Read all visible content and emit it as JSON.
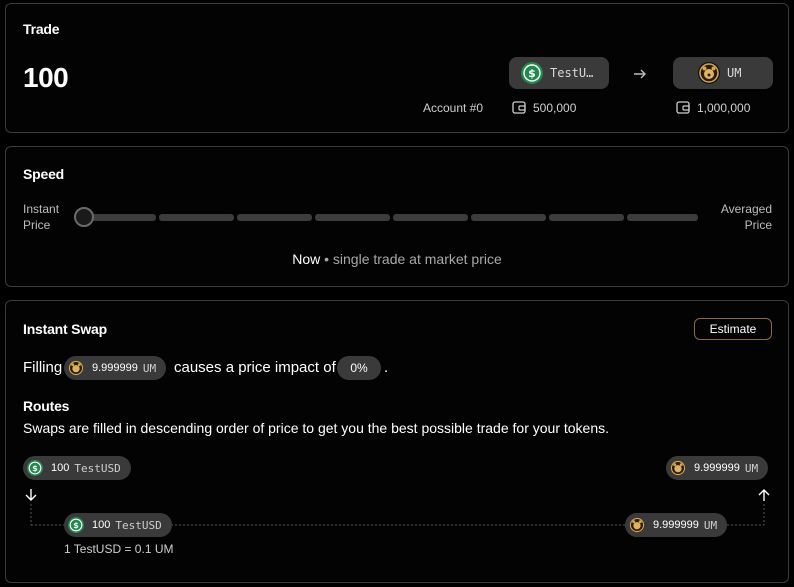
{
  "trade": {
    "title": "Trade",
    "amount": "100",
    "from_asset": "TestU…",
    "to_asset": "UM",
    "account_label": "Account #0",
    "from_balance": "500,000",
    "to_balance": "1,000,000"
  },
  "speed": {
    "title": "Speed",
    "left_label_line1": "Instant",
    "left_label_line2": "Price",
    "right_label_line1": "Averaged",
    "right_label_line2": "Price",
    "desc_strong": "Now",
    "desc_rest": " • single trade at market price",
    "slider_value": 0
  },
  "swap": {
    "title": "Instant Swap",
    "estimate_label": "Estimate",
    "filling_prefix": "Filling",
    "filling_amount": "9.999999",
    "filling_symbol": "UM",
    "impact_text": "causes a price impact of",
    "impact_value": "0%",
    "period": ".",
    "routes_title": "Routes",
    "routes_desc": "Swaps are filled in descending order of price to get you the best possible trade for your tokens.",
    "route_start": {
      "amount": "100",
      "symbol": "TestUSD"
    },
    "route_end": {
      "amount": "9.999999",
      "symbol": "UM"
    },
    "hop_in": {
      "amount": "100",
      "symbol": "TestUSD"
    },
    "hop_out": {
      "amount": "9.999999",
      "symbol": "UM"
    },
    "hop_rate": "1 TestUSD = 0.1 UM"
  },
  "colors": {
    "usd_green": "#1f8a4c",
    "um_gold": "#d4a84a",
    "estimate_border": "#8a6b3c"
  },
  "icons": [
    "usd-coin-icon",
    "um-token-icon",
    "arrow-right-icon",
    "wallet-icon",
    "arrow-down-icon",
    "arrow-up-icon"
  ]
}
